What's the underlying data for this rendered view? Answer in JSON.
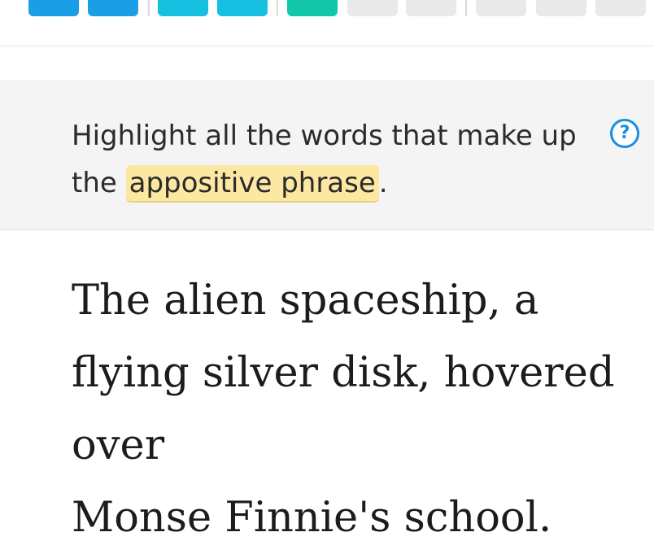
{
  "progress": {
    "segments": [
      {
        "state": "complete",
        "color": "#1a9ee5"
      },
      {
        "state": "complete",
        "color": "#1a9ee5"
      },
      {
        "state": "complete",
        "color": "#14bfe0"
      },
      {
        "state": "complete",
        "color": "#14bfe0"
      },
      {
        "state": "current",
        "color": "#12c6aa"
      },
      {
        "state": "incomplete",
        "color": "#e9e9ea"
      },
      {
        "state": "incomplete",
        "color": "#e9e9ea"
      },
      {
        "state": "incomplete",
        "color": "#e9e9ea"
      },
      {
        "state": "incomplete",
        "color": "#e9e9ea"
      },
      {
        "state": "incomplete",
        "color": "#e9e9ea"
      }
    ]
  },
  "instruction": {
    "line_before": "Highlight all the words that make up the ",
    "highlighted_term": "appositive phrase",
    "line_after": ".",
    "highlight_color": "#fde8a3"
  },
  "help": {
    "icon": "question-circle-icon",
    "glyph": "?",
    "color": "#1a8fe0"
  },
  "sentence": {
    "words": [
      "The",
      "alien",
      "spaceship,",
      "a",
      "flying",
      "silver",
      "disk,",
      "hovered",
      "over",
      "Monse",
      "Finnie's",
      "school."
    ]
  }
}
